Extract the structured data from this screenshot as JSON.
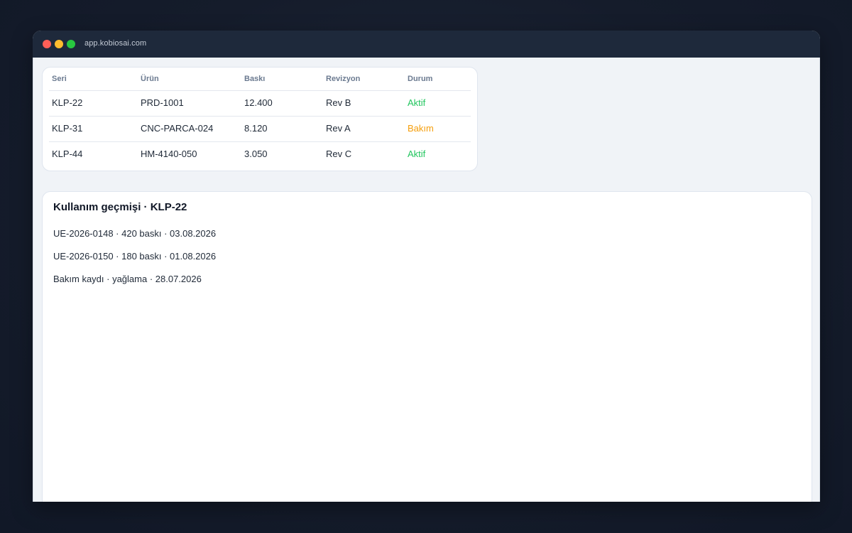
{
  "window": {
    "url": "app.kobiosai.com",
    "traffic_lights": [
      {
        "name": "close",
        "color": "#ff5f57"
      },
      {
        "name": "minimize",
        "color": "#febc2e"
      },
      {
        "name": "maximize",
        "color": "#28c840"
      }
    ]
  },
  "table": {
    "headers": [
      "Seri",
      "Ürün",
      "Baskı",
      "Revizyon",
      "Durum"
    ],
    "rows": [
      {
        "seri": "KLP-22",
        "urun": "PRD-1001",
        "baski": "12.400",
        "revizyon": "Rev B",
        "durum": "Aktif",
        "durum_color": "#22c55e"
      },
      {
        "seri": "KLP-31",
        "urun": "CNC-PARCA-024",
        "baski": "8.120",
        "revizyon": "Rev A",
        "durum": "Bakım",
        "durum_color": "#f59e0b"
      },
      {
        "seri": "KLP-44",
        "urun": "HM-4140-050",
        "baski": "3.050",
        "revizyon": "Rev C",
        "durum": "Aktif",
        "durum_color": "#22c55e"
      }
    ]
  },
  "history": {
    "title": "Kullanım geçmişi · KLP-22",
    "items": [
      "UE-2026-0148 · 420 baskı · 03.08.2026",
      "UE-2026-0150 · 180 baskı · 01.08.2026",
      "Bakım kaydı · yağlama · 28.07.2026"
    ]
  }
}
